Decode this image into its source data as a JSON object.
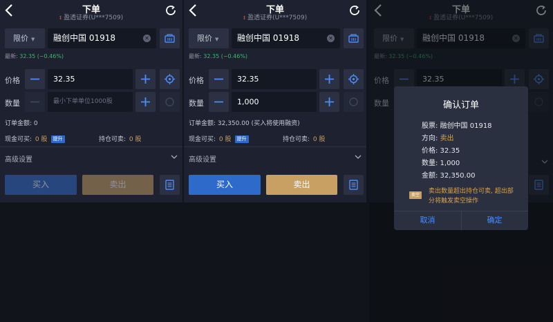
{
  "header": {
    "title": "下单",
    "broker": "盈透证券(U***7509)"
  },
  "order": {
    "order_type": "限价",
    "symbol": "融创中国 01918",
    "latest_label": "最新:",
    "latest_value": "32.35 (−0.46%)",
    "price_label": "价格",
    "qty_label": "数量",
    "price_value": "32.35",
    "qty_placeholder": "最小下单单位1000股",
    "qty_value": "1,000",
    "amount_label_empty": "订单金额: 0",
    "amount_label_filled": "订单金额: 32,350.00 (买入将使用融资)",
    "cash_label": "现金可买:",
    "cash_value": "0 股",
    "cash_tag": "提升",
    "hold_label": "持仓可卖:",
    "hold_value": "0 股",
    "advanced": "高级设置",
    "buy": "买入",
    "sell": "卖出"
  },
  "dialog": {
    "title": "确认订单",
    "stock": "股票: 融创中国 01918",
    "direction_label": "方向: ",
    "direction_value": "卖出",
    "price": "价格: 32.35",
    "qty": "数量: 1,000",
    "amount": "金额: 32,350.00",
    "short_tag": "卖空",
    "warning": "卖出数量超出持仓可卖, 超出部分将触发卖空操作",
    "cancel": "取消",
    "confirm": "确定"
  },
  "colors": {
    "accent_blue": "#2e6ac9",
    "sell_gold": "#c9a063",
    "up_green": "#3fb86b"
  }
}
